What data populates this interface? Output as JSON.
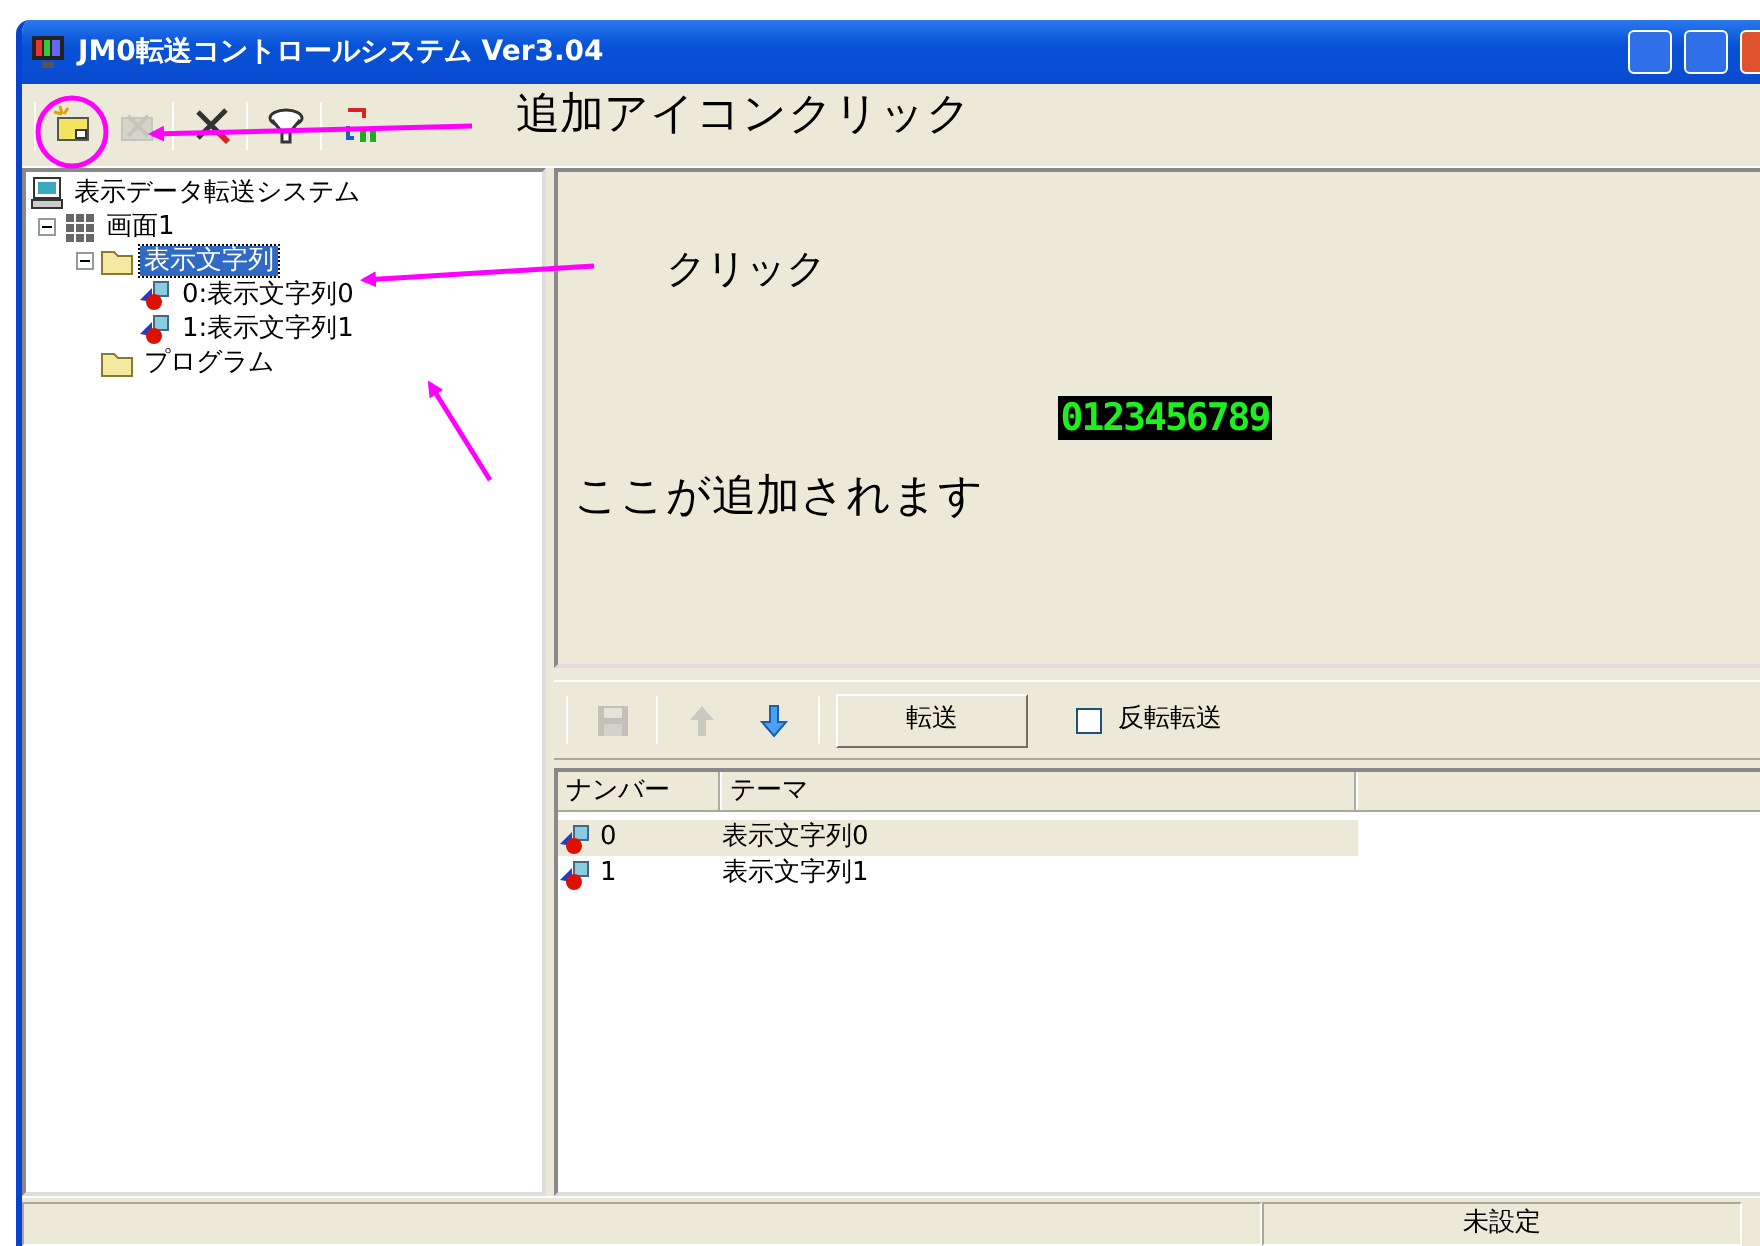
{
  "window": {
    "title": "JM0転送コントロールシステム Ver3.04"
  },
  "toolbar": [
    {
      "kind": "add",
      "disabled": false
    },
    {
      "kind": "delete",
      "disabled": true
    },
    {
      "kind": "tools",
      "disabled": false
    },
    {
      "kind": "filter",
      "disabled": false
    },
    {
      "kind": "transfer",
      "disabled": false
    }
  ],
  "tree": {
    "label": "表示データ転送システム",
    "kind": "system",
    "selected": false,
    "children": [
      {
        "label": "画面1",
        "kind": "screen",
        "selected": false,
        "expanded": true,
        "children": [
          {
            "label": "表示文字列",
            "kind": "folder",
            "selected": true,
            "expanded": true,
            "children": [
              {
                "label": "0:表示文字列0",
                "kind": "string",
                "selected": false
              },
              {
                "label": "1:表示文字列1",
                "kind": "string",
                "selected": false
              }
            ]
          },
          {
            "label": "プログラム",
            "kind": "folder",
            "selected": false
          }
        ]
      }
    ]
  },
  "preview": {
    "display_text": "0123456789"
  },
  "list_toolbar": {
    "tools": [
      {
        "kind": "save",
        "disabled": true
      },
      {
        "kind": "up",
        "disabled": true
      },
      {
        "kind": "down",
        "disabled": false
      }
    ],
    "transfer_button": "転送",
    "invert_checkbox": {
      "label": "反転転送",
      "checked": false
    }
  },
  "list": {
    "columns": [
      "ナンバー",
      "テーマ"
    ],
    "rows": [
      {
        "number": "0",
        "theme": "表示文字列0",
        "selected": true
      },
      {
        "number": "1",
        "theme": "表示文字列1",
        "selected": false
      }
    ]
  },
  "status_bar": {
    "state": "未設定"
  },
  "annotations": [
    {
      "kind": "label",
      "text": "追加アイコンクリック"
    },
    {
      "kind": "label",
      "text": "クリック"
    },
    {
      "kind": "label",
      "text": "ここが追加されます"
    }
  ]
}
